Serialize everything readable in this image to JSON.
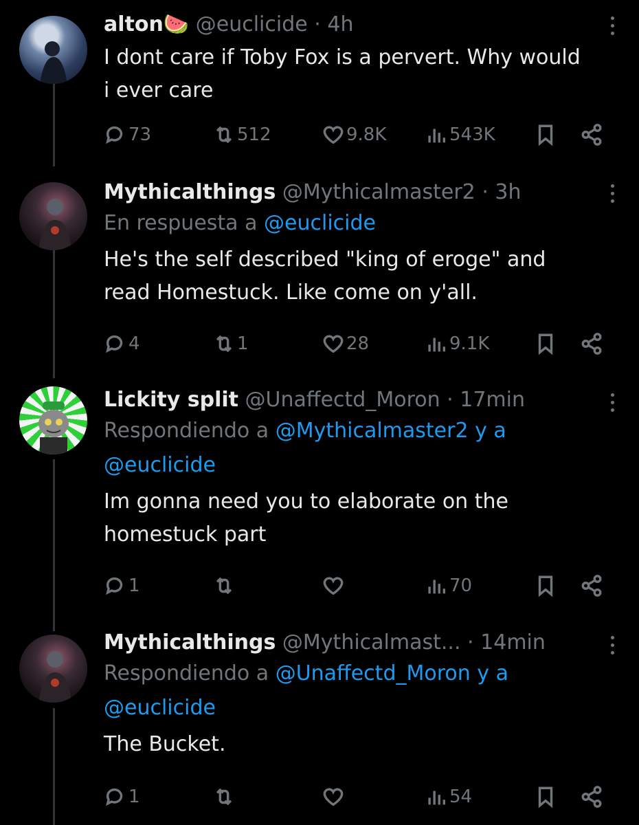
{
  "tweets": [
    {
      "name": "alton",
      "emoji": "🍉",
      "handle": "@euclicide",
      "time": "4h",
      "reply_prefix": "",
      "reply_targets": "",
      "reply_targets2": "",
      "text_lines": [
        "I dont care if Toby Fox is a pervert. Why would",
        "i ever care"
      ],
      "replies": "73",
      "reposts": "512",
      "likes": "9.8K",
      "views": "543K"
    },
    {
      "name": "Mythicalthings",
      "handle": "@Mythicalmaster2",
      "time": "3h",
      "reply_prefix": "En respuesta a ",
      "reply_targets": "@euclicide",
      "reply_targets2": "",
      "text_lines": [
        "He's the self described \"king of eroge\" and",
        "read Homestuck. Like come on y'all."
      ],
      "replies": "4",
      "reposts": "1",
      "likes": "28",
      "views": "9.1K"
    },
    {
      "name": "Lickity split",
      "handle": "@Unaffectd_Moron",
      "time": "17min",
      "reply_prefix": "Respondiendo a ",
      "reply_targets": "@Mythicalmaster2 y a",
      "reply_targets2": "@euclicide",
      "text_lines": [
        "Im gonna need you to elaborate on the",
        "homestuck part"
      ],
      "replies": "1",
      "reposts": "",
      "likes": "",
      "views": "70"
    },
    {
      "name": "Mythicalthings",
      "handle": "@Mythicalmast...",
      "time": "14min",
      "reply_prefix": "Respondiendo a ",
      "reply_targets": "@Unaffectd_Moron y a",
      "reply_targets2": "@euclicide",
      "text_lines": [
        "The Bucket."
      ],
      "replies": "1",
      "reposts": "",
      "likes": "",
      "views": "54"
    }
  ],
  "sep": "·",
  "icons": [
    "reply-icon",
    "repost-icon",
    "like-icon",
    "views-icon",
    "bookmark-icon",
    "share-icon",
    "more-icon"
  ],
  "colors": {
    "background": "#000000",
    "text": "#e7e9ea",
    "muted": "#71767b",
    "link": "#1d9bf0"
  }
}
